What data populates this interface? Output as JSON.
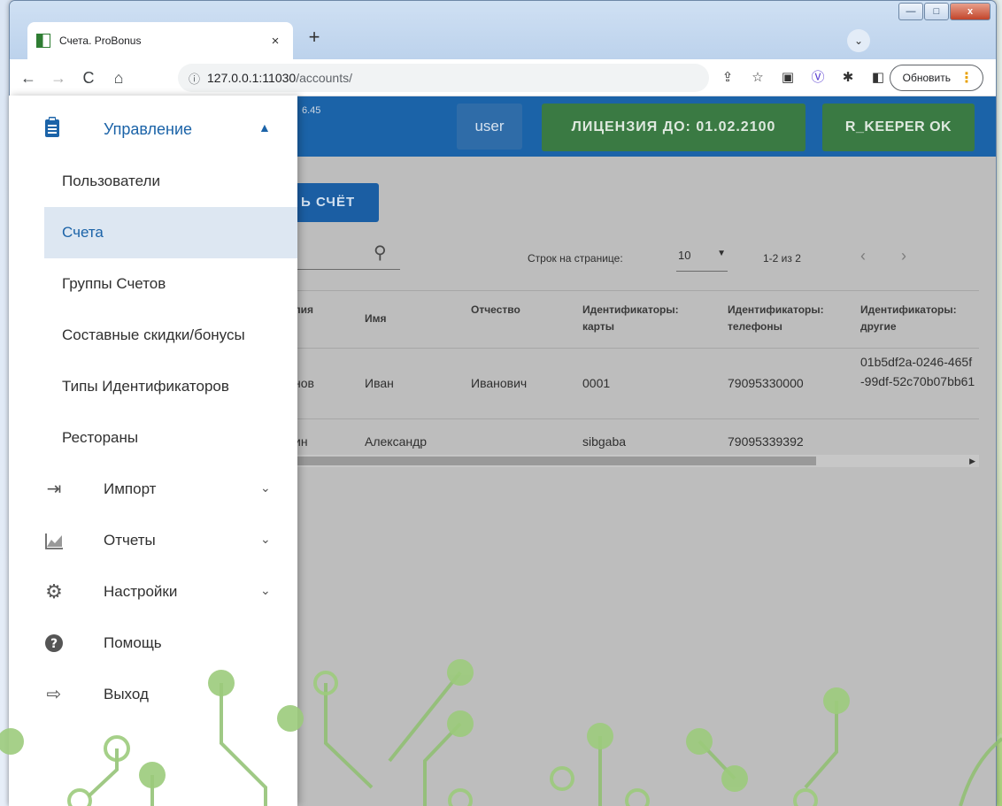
{
  "browser": {
    "tab_title": "Счета. ProBonus",
    "tab_close": "×",
    "new_tab": "+",
    "tab_search": "⌄",
    "address": {
      "host": "127.0.0.1:11030",
      "path": "/accounts/"
    },
    "update_label": "Обновить",
    "window_controls": {
      "minimize": "—",
      "maximize": "□",
      "close": "x"
    }
  },
  "appbar": {
    "version": "6.45",
    "user": "user",
    "license": "ЛИЦЕНЗИЯ ДО: 01.02.2100",
    "rkeeper": "R_KEEPER OK"
  },
  "content": {
    "create_button": "Ь СЧЁТ",
    "rows_per_page_label": "Строк на странице:",
    "rows_per_page_value": "10",
    "range": "1-2 из 2"
  },
  "table": {
    "headers": [
      "лия",
      "Имя",
      "Отчество",
      "Идентификаторы: карты",
      "Идентификаторы: телефоны",
      "Идентификаторы: другие"
    ],
    "rows": [
      [
        "нов",
        "Иван",
        "Иванович",
        "0001",
        "79095330000",
        "01b5df2a-0246-465f-99df-52c70b07bb61"
      ],
      [
        "ин",
        "Александр",
        "",
        "sibgaba",
        "79095339392",
        ""
      ]
    ]
  },
  "sidebar": {
    "section": {
      "label": "Управление",
      "icon": "clipboard-icon"
    },
    "sub_items": [
      {
        "label": "Пользователи",
        "active": false
      },
      {
        "label": "Счета",
        "active": true
      },
      {
        "label": "Группы Счетов",
        "active": false
      },
      {
        "label": "Составные скидки/бонусы",
        "active": false
      },
      {
        "label": "Типы Идентификаторов",
        "active": false
      },
      {
        "label": "Рестораны",
        "active": false
      }
    ],
    "items": [
      {
        "label": "Импорт",
        "icon": "import-icon",
        "expandable": true
      },
      {
        "label": "Отчеты",
        "icon": "chart-icon",
        "expandable": true
      },
      {
        "label": "Настройки",
        "icon": "gear-icon",
        "expandable": true
      },
      {
        "label": "Помощь",
        "icon": "help-icon",
        "expandable": false
      },
      {
        "label": "Выход",
        "icon": "logout-icon",
        "expandable": false
      }
    ]
  },
  "colors": {
    "primary": "#1b63a8",
    "success": "#3a7a43",
    "active_bg": "#dde7f2"
  }
}
